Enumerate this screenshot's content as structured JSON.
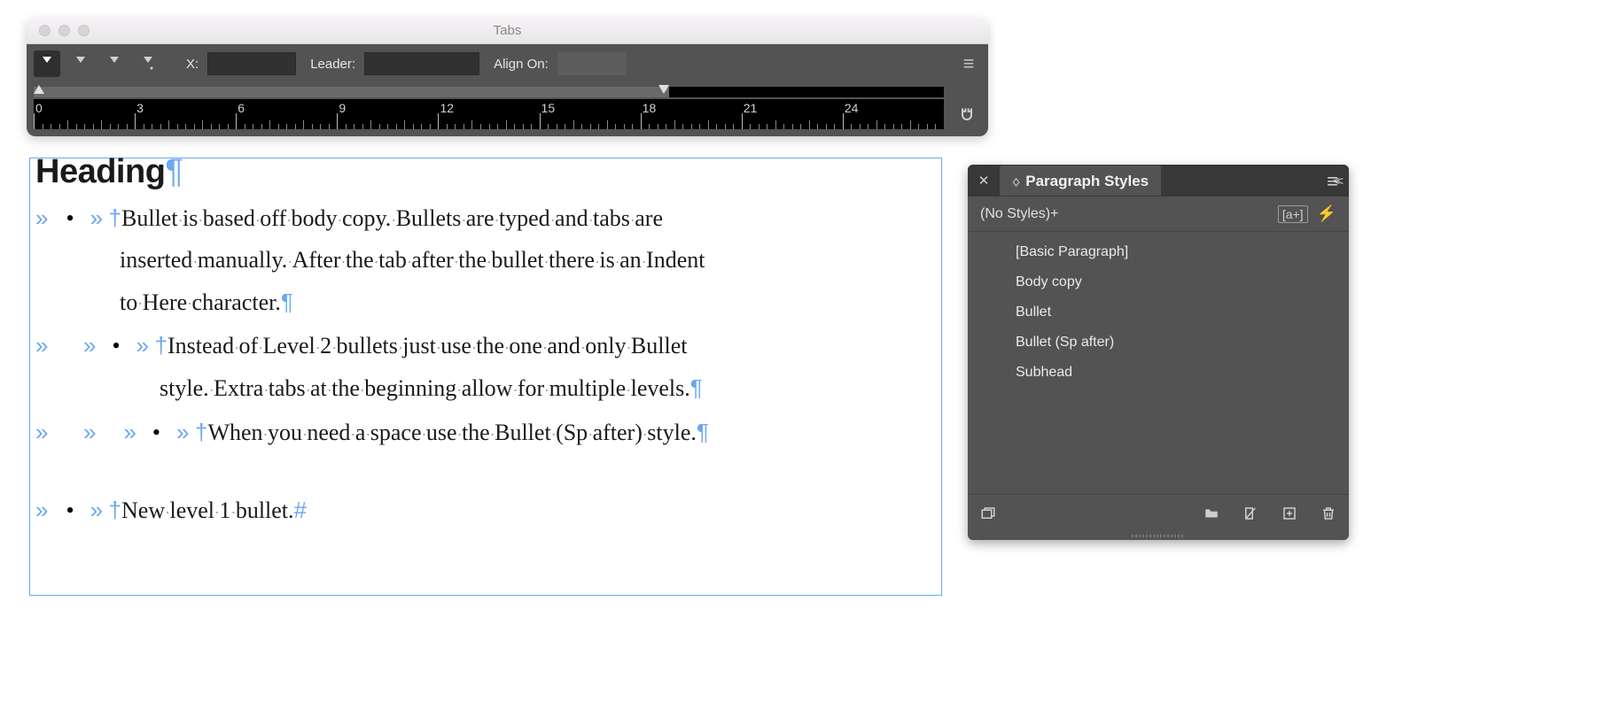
{
  "tabs_panel": {
    "title": "Tabs",
    "x_label": "X:",
    "x_value": "",
    "leader_label": "Leader:",
    "leader_value": "",
    "alignon_label": "Align On:",
    "alignon_value": "",
    "ruler_numbers": [
      "0",
      "3",
      "6",
      "9",
      "12",
      "15",
      "18",
      "21",
      "24"
    ]
  },
  "document": {
    "heading": "Heading",
    "bullet1_l1": "Bullet is based off body copy. Bullets are typed and tabs are",
    "bullet1_l2": "inserted manually. After the tab after the bullet there is an Indent",
    "bullet1_l3": "to Here character.",
    "bullet2_l1": "Instead of Level 2 bullets just use the one and only Bullet",
    "bullet2_l2": "style. Extra tabs at the beginning allow for multiple levels.",
    "bullet3_l1": "When you need a space use the Bullet (Sp after) style.",
    "bullet4_l1": "New level 1 bullet."
  },
  "pstyles": {
    "title": "Paragraph Styles",
    "current": "(No Styles)+",
    "override_badge": "[a+]",
    "items": [
      "[Basic Paragraph]",
      "Body copy",
      "Bullet",
      "Bullet (Sp after)",
      "Subhead"
    ]
  }
}
